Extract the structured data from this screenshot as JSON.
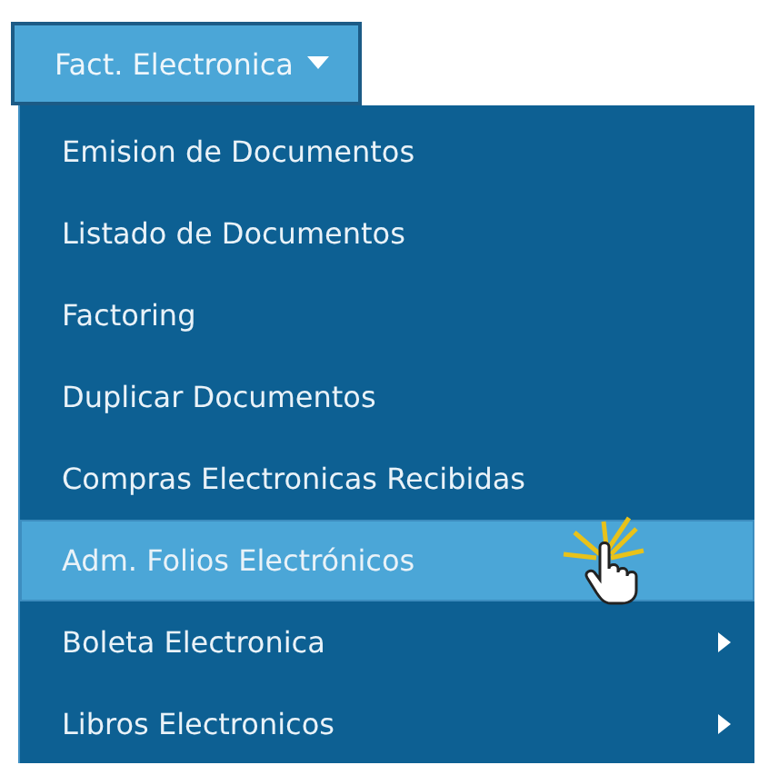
{
  "menu_button": {
    "label": "Fact. Electronica",
    "expanded": true
  },
  "menu_items": [
    {
      "label": "Emision de Documentos",
      "selected": false,
      "kind": "action"
    },
    {
      "label": "Listado de Documentos",
      "selected": false,
      "kind": "action"
    },
    {
      "label": "Factoring",
      "selected": false,
      "kind": "action"
    },
    {
      "label": "Duplicar Documentos",
      "selected": false,
      "kind": "action"
    },
    {
      "label": "Compras Electronicas Recibidas",
      "selected": false,
      "kind": "action"
    },
    {
      "label": "Adm. Folios Electrónicos",
      "selected": true,
      "kind": "action"
    },
    {
      "label": "Boleta Electronica",
      "selected": false,
      "kind": "submenu"
    },
    {
      "label": "Libros Electronicos",
      "selected": false,
      "kind": "submenu"
    }
  ]
}
